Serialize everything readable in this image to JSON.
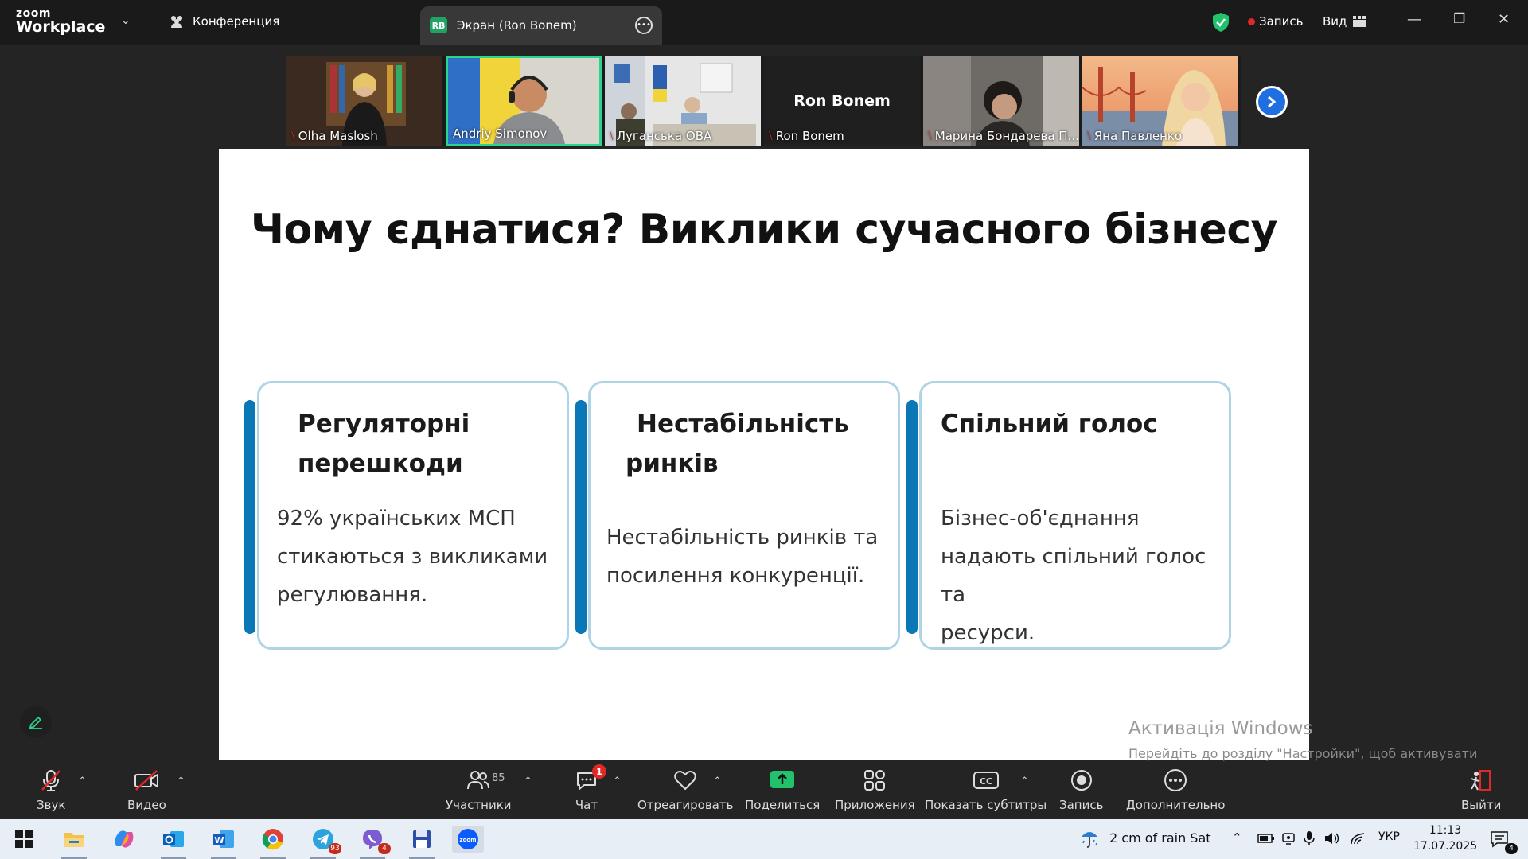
{
  "titlebar": {
    "logo_line1": "zoom",
    "logo_line2": "Workplace",
    "conference_label": "Конференция",
    "screen_tab_initials": "RB",
    "screen_tab_label": "Экран (Ron Bonem)",
    "record_label": "Запись",
    "view_label": "Вид"
  },
  "gallery": {
    "participants": [
      {
        "name": "Olha Maslosh",
        "muted": true
      },
      {
        "name": "Andriy Simonov",
        "muted": false,
        "active_speaker": true
      },
      {
        "name": "Луганська ОВА",
        "muted": true
      },
      {
        "name": "Ron Bonem",
        "muted": true,
        "display_name_big": "Ron Bonem"
      },
      {
        "name": "Марина Бондарева П...",
        "muted": true
      },
      {
        "name": "Яна Павленко",
        "muted": true
      }
    ]
  },
  "slide": {
    "title": "Чому єднатися? Виклики сучасного бізнесу",
    "cards": [
      {
        "heading_line1": "Регуляторні",
        "heading_line2": "перешкоди",
        "body": [
          "92% українських МСП",
          "стикаються з викликами",
          "регулювання."
        ]
      },
      {
        "heading_line1": "Нестабільність",
        "heading_line2": "ринків",
        "body": [
          "Нестабільність ринків та",
          "посилення конкуренції."
        ]
      },
      {
        "heading_line1": "Спільний голос",
        "heading_line2": "",
        "body": [
          "Бізнес-об'єднання",
          "надають спільний голос та",
          "ресурси."
        ]
      }
    ]
  },
  "watermark": {
    "title": "Активація Windows",
    "text": "Перейдіть до розділу \"Настройки\", щоб активувати Windows."
  },
  "toolbar": {
    "audio": "Звук",
    "video": "Видео",
    "participants": "Участники",
    "participants_count": "85",
    "chat": "Чат",
    "chat_badge": "1",
    "react": "Отреагировать",
    "share": "Поделиться",
    "apps": "Приложения",
    "captions": "Показать субтитры",
    "record": "Запись",
    "more": "Дополнительно",
    "leave": "Выйти"
  },
  "taskbar": {
    "telegram_badge": "93",
    "viber_badge": "4",
    "weather": "2 cm of rain Sat",
    "language": "УКР",
    "time": "11:13",
    "date": "17.07.2025",
    "notifications": "4"
  },
  "colors": {
    "accent_blue": "#0a77b6",
    "card_border": "#aed4e6",
    "active_speaker": "#2ad48c",
    "share_green": "#21c26b",
    "record_red": "#e02828"
  }
}
